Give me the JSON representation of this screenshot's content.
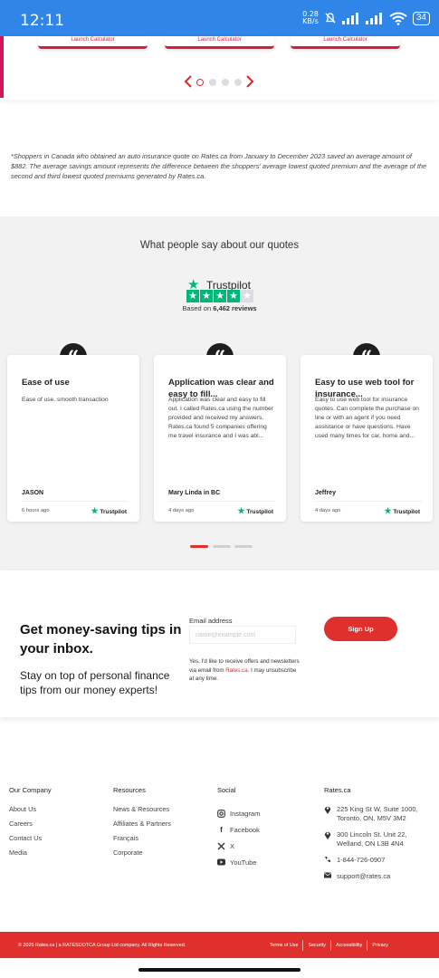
{
  "status_bar": {
    "time": "12:11",
    "net_speed_top": "0.28",
    "net_speed_bottom": "KB/s",
    "battery": "34"
  },
  "carousel": {
    "button_label": "Launch Calculator",
    "prev_symbol": "‹",
    "next_symbol": "›"
  },
  "disclaimer": "*Shoppers in Canada who obtained an auto insurance quote on Rates.ca from January to December 2023 saved an average amount of $882. The average savings amount represents the difference between the shoppers' average lowest quoted premium and the average of the second and third lowest quoted premiums generated by Rates.ca.",
  "reviews": {
    "title": "What people say about our quotes",
    "trustpilot_name": "Trustpilot",
    "based_on_prefix": "Based on ",
    "based_on_count": "6,462 reviews",
    "cards": [
      {
        "title": "Ease of use",
        "body": "Ease of use. smooth transaction",
        "author": "JASON",
        "time": "6 hours ago",
        "source": "Trustpilot"
      },
      {
        "title": "Application was clear and easy to fill...",
        "body": "Application was clear and easy to fill out. I called Rates.ca using the number provided and received my answers. Rates.ca found 5 companies offering me travel insurance and I was abl...",
        "author": "Mary Linda in BC",
        "time": "4 days ago",
        "source": "Trustpilot"
      },
      {
        "title": "Easy to use web tool for insurance...",
        "body": "Easy to use web tool for insurance quotes. Can complete the purchase on line or with an agent if you need assistance or have questions. Have used many times for car, home and...",
        "author": "Jeffrey",
        "time": "4 days ago",
        "source": "Trustpilot"
      }
    ]
  },
  "newsletter": {
    "heading": "Get money-saving tips in your inbox.",
    "subheading": "Stay on top of personal finance tips from our money experts!",
    "email_label": "Email address",
    "email_placeholder": "name@example.com",
    "consent_before": "Yes, I'd like to receive offers and newsletters via email from ",
    "consent_link": "Rates.ca",
    "consent_after": ". I may unsubscribe at any time.",
    "signup_label": "Sign Up"
  },
  "footer": {
    "company": {
      "heading": "Our Company",
      "links": [
        "About Us",
        "Careers",
        "Contact Us",
        "Media"
      ]
    },
    "resources": {
      "heading": "Resources",
      "links": [
        "News & Resources",
        "Affiliates & Partners",
        "Français",
        "Corporate"
      ]
    },
    "social": {
      "heading": "Social",
      "links": [
        {
          "label": "Instagram",
          "icon": "instagram-icon"
        },
        {
          "label": "Facebook",
          "icon": "facebook-icon"
        },
        {
          "label": "X",
          "icon": "x-icon"
        },
        {
          "label": "YouTube",
          "icon": "youtube-icon"
        }
      ]
    },
    "rates": {
      "heading": "Rates.ca",
      "address1_line1": "225 King St W, Suite 1000,",
      "address1_line2": "Toronto, ON, M5V 3M2",
      "address2_line1": "300 Lincoln St. Unit 22,",
      "address2_line2": "Welland, ON L3B 4N4",
      "phone": "1-844-726-0907",
      "email": "support@rates.ca"
    }
  },
  "footer_bar": {
    "copyright": "© 2025 Rates.ca | a RATESDOTCA Group Ltd company. All Rights Reserved.",
    "links": [
      "Terms of Use",
      "Security",
      "Accessibility",
      "Privacy"
    ]
  },
  "colors": {
    "status_bar": "#2f86e8",
    "accent_red": "#e0302d",
    "trustpilot_green": "#00b67a"
  }
}
